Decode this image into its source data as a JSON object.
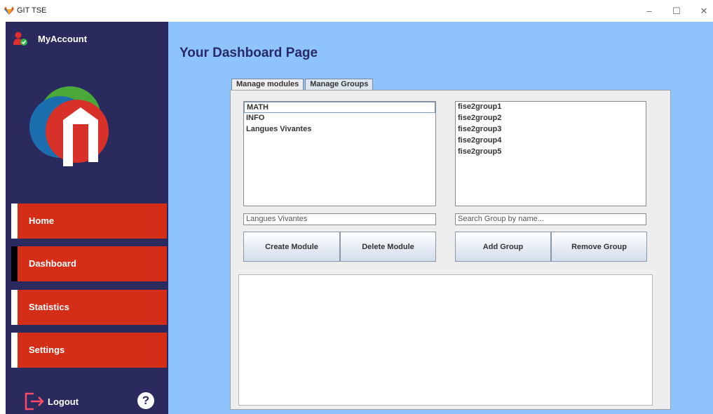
{
  "window": {
    "title": "GIT TSE",
    "controls": {
      "minimize": "–",
      "maximize": "☐",
      "close": "✕"
    }
  },
  "sidebar": {
    "account_label": "MyAccount",
    "account_icon": "user-check-icon",
    "logo": "app-logo",
    "nav": [
      {
        "label": "Home",
        "active": false
      },
      {
        "label": "Dashboard",
        "active": true
      },
      {
        "label": "Statistics",
        "active": false
      },
      {
        "label": "Settings",
        "active": false
      }
    ],
    "logout_label": "Logout",
    "help_label": "?",
    "colors": {
      "background": "#2b2a5e",
      "nav": "#d42e18"
    }
  },
  "main": {
    "page_title": "Your Dashboard Page",
    "tabs": [
      {
        "label": "Manage modules",
        "active": true
      },
      {
        "label": "Manage Groups",
        "active": false
      }
    ],
    "modules": [
      "MATH",
      "INFO",
      "Langues Vivantes"
    ],
    "groups": [
      "fise2group1",
      "fise2group2",
      "fise2group3",
      "fise2group4",
      "fise2group5"
    ],
    "module_input": {
      "value": "Langues Vivantes"
    },
    "group_input": {
      "placeholder": "Search Group by name..."
    },
    "buttons": {
      "create_module": "Create Module",
      "delete_module": "Delete Module",
      "add_group": "Add Group",
      "remove_group": "Remove Group"
    },
    "colors": {
      "background": "#8ec4fb",
      "title": "#272a66"
    }
  }
}
